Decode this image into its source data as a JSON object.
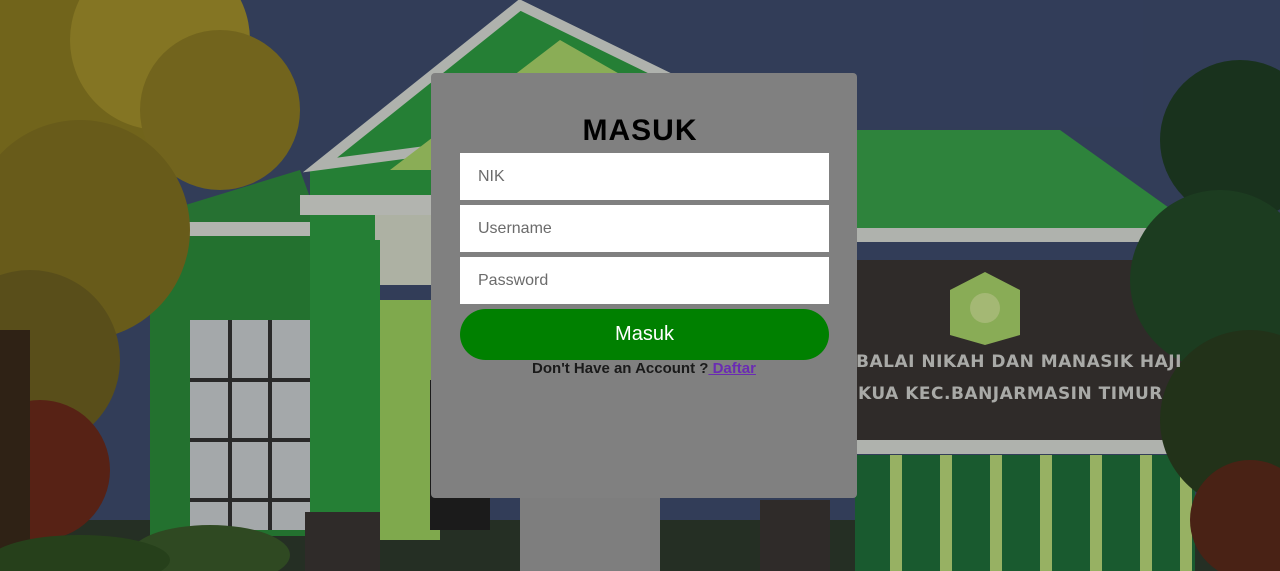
{
  "background": {
    "sign_line_1": "BALAI NIKAH DAN MANASIK HAJI",
    "sign_line_2": "KUA KEC.BANJARMASIN TIMUR"
  },
  "login": {
    "title": "MASUK",
    "nik_placeholder": "NIK",
    "username_placeholder": "Username",
    "password_placeholder": "Password",
    "submit_label": "Masuk",
    "no_account_text": "Don't Have an Account ?",
    "register_link": " Daftar"
  },
  "colors": {
    "card_bg": "#808080",
    "button_bg": "#008000",
    "link": "#6a2bb3"
  }
}
